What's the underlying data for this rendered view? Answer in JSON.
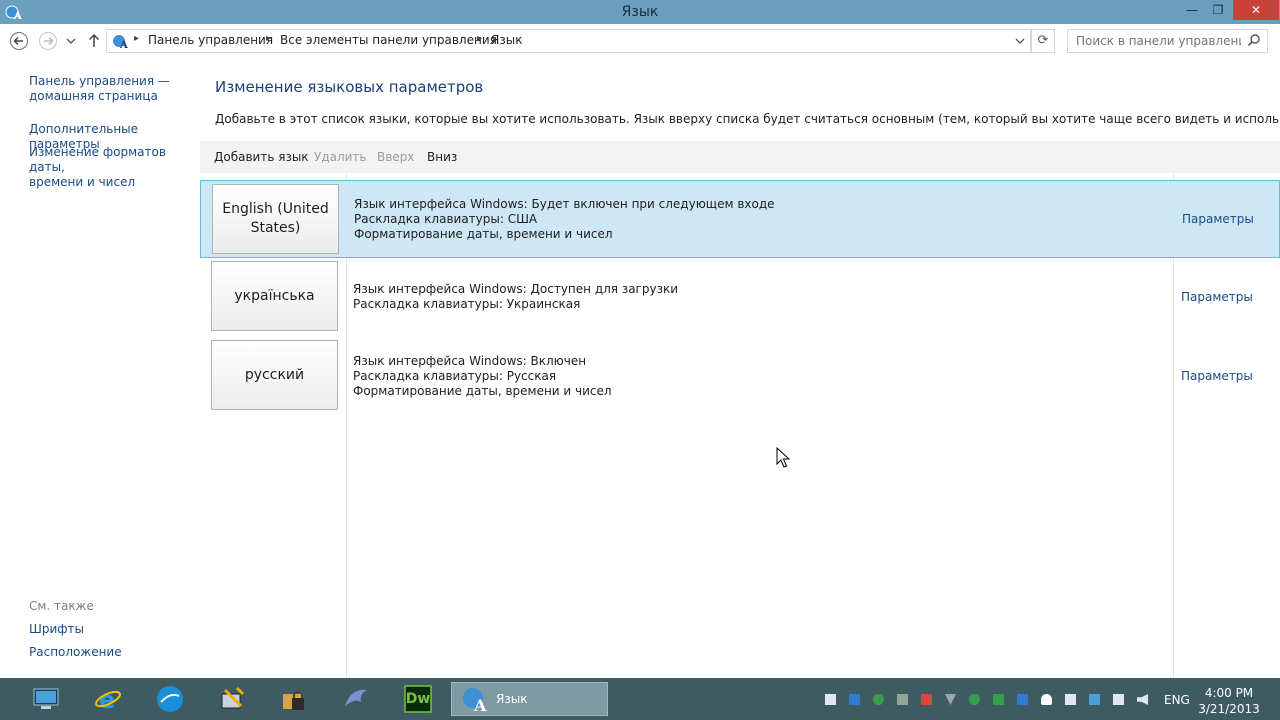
{
  "window": {
    "title": "Язык"
  },
  "breadcrumb": [
    "Панель управления",
    "Все элементы панели управления",
    "Язык"
  ],
  "search": {
    "placeholder": "Поиск в панели управления"
  },
  "left_pane": {
    "home_link": [
      "Панель управления —",
      "домашняя страница"
    ],
    "advanced_link": "Дополнительные параметры",
    "date_formats_link": [
      "Изменение форматов даты,",
      "времени и чисел"
    ],
    "see_also_heading": "См. также",
    "fonts_link": "Шрифты",
    "location_link": "Расположение"
  },
  "main": {
    "title": "Изменение языковых параметров",
    "description": "Добавьте в этот список языки, которые вы хотите использовать. Язык вверху списка будет считаться основным (тем, который вы хотите чаще всего видеть и использовать).",
    "toolbar": {
      "add": "Добавить язык",
      "remove": "Удалить",
      "up": "Вверх",
      "down": "Вниз"
    },
    "languages": [
      {
        "name": [
          "English (United",
          "States)"
        ],
        "info": [
          "Язык интерфейса Windows: Будет включен при следующем входе",
          "Раскладка клавиатуры: США",
          "Форматирование даты, времени и чисел"
        ],
        "options_label": "Параметры",
        "selected": true
      },
      {
        "name": [
          "українська"
        ],
        "info": [
          "Язык интерфейса Windows: Доступен для загрузки",
          "Раскладка клавиатуры: Украинская"
        ],
        "options_label": "Параметры",
        "selected": false
      },
      {
        "name": [
          "русский"
        ],
        "info": [
          "Язык интерфейса Windows: Включен",
          "Раскладка клавиатуры: Русская",
          "Форматирование даты, времени и чисел"
        ],
        "options_label": "Параметры",
        "selected": false
      }
    ]
  },
  "taskbar": {
    "apps": [
      "explorer-icon",
      "internet-explorer-icon",
      "browser-globe-icon",
      "network-tool-icon",
      "locked-folder-icon",
      "dolphin-icon",
      "dreamweaver-icon"
    ],
    "dreamweaver_text": "Dw",
    "active_window_label": "Язык",
    "input_language": "ENG",
    "time": "4:00 PM",
    "date": "3/21/2013"
  },
  "colors": {
    "titlebar": "#6a9fc0",
    "taskbar": "#3f5b62",
    "selection": "#cde8f4",
    "link": "#1a4a8a",
    "heading": "#1e3e7a"
  }
}
